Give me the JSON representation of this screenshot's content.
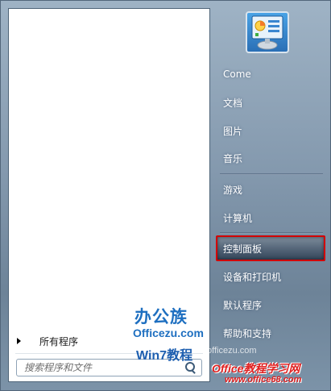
{
  "left_pane": {
    "all_programs_label": "所有程序",
    "search_placeholder": "搜索程序和文件"
  },
  "right_pane": {
    "items": [
      {
        "label": "Come"
      },
      {
        "label": "文档"
      },
      {
        "label": "图片"
      },
      {
        "label": "音乐"
      },
      {
        "label": "游戏"
      },
      {
        "label": "计算机"
      },
      {
        "label": "控制面板"
      },
      {
        "label": "设备和打印机"
      },
      {
        "label": "默认程序"
      },
      {
        "label": "帮助和支持"
      }
    ],
    "highlighted_item": "控制面板"
  },
  "watermarks": {
    "title": "办公族",
    "domain": "Officezu.com",
    "tutorial": "Win7教程",
    "faint_domain": "officezu.com",
    "brand": "Office教程学习网",
    "brand_url": "www.office68.com"
  },
  "colors": {
    "highlight_border": "#d20000",
    "watermark_blue": "#1e6fc0",
    "watermark_red": "#e02020"
  }
}
